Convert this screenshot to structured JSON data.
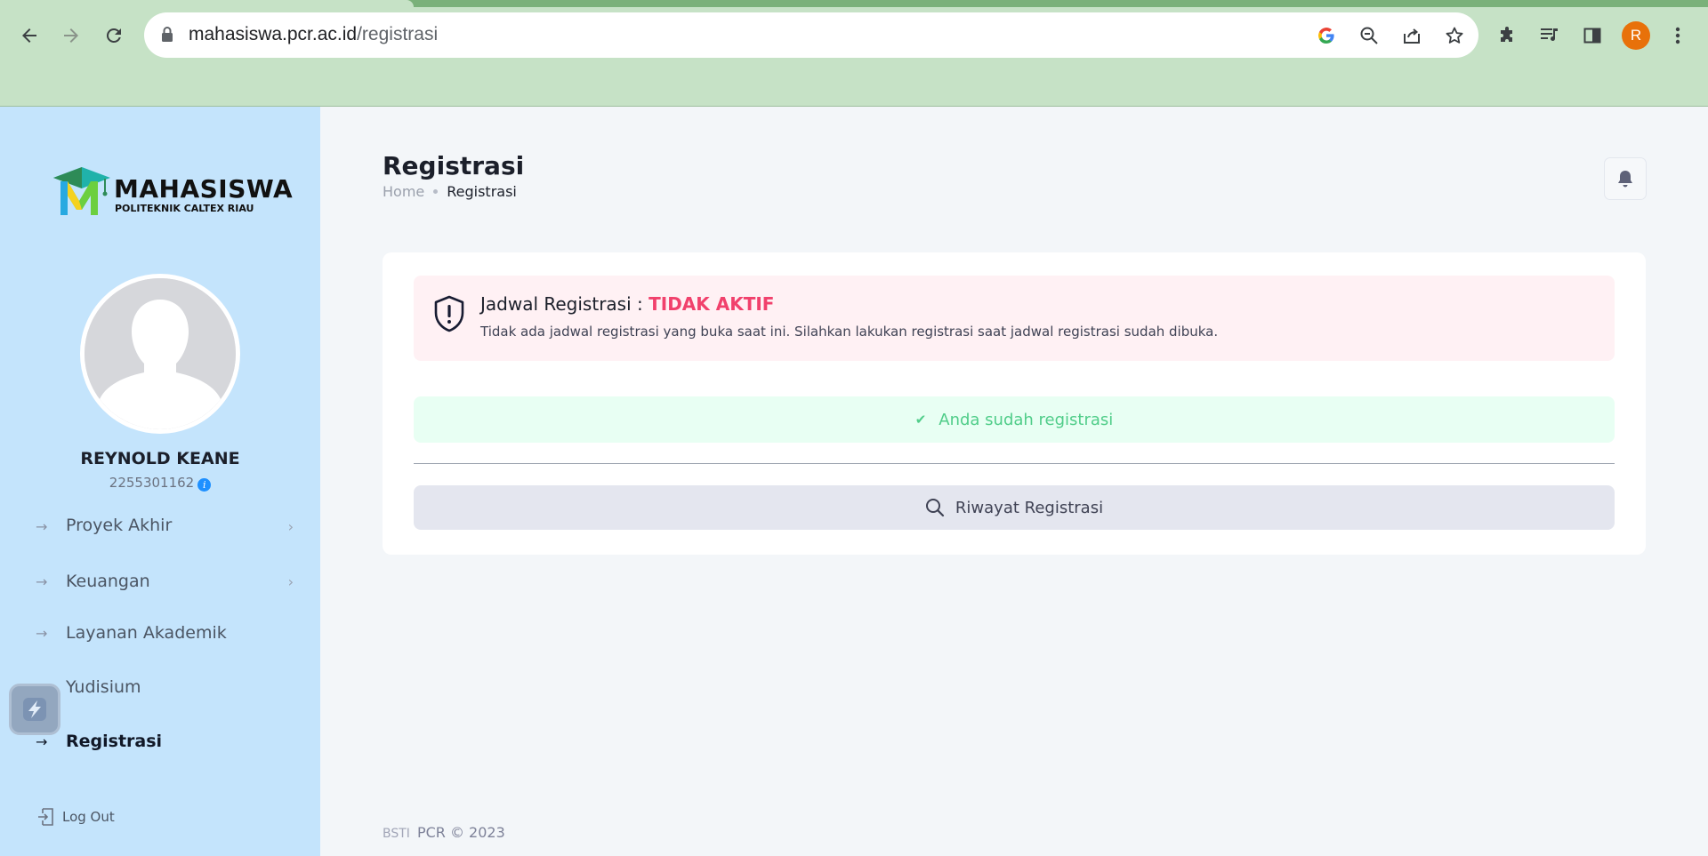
{
  "browser": {
    "url_domain": "mahasiswa.pcr.ac.id",
    "url_path": "/registrasi",
    "profile_initial": "R",
    "icons": [
      "back-icon",
      "forward-icon",
      "reload-icon",
      "lock-icon",
      "google-icon",
      "zoom-out-icon",
      "share-icon",
      "star-icon",
      "extensions-icon",
      "media-queue-icon",
      "side-panel-icon",
      "menu-dots-icon"
    ]
  },
  "sidebar": {
    "brand": "MAHASISWA",
    "brand_sub": "POLITEKNIK CALTEX RIAU",
    "user": {
      "name": "REYNOLD KEANE",
      "nim": "2255301162",
      "info_glyph": "i"
    },
    "menu": [
      {
        "label": "Proyek Akhir",
        "has_children": true
      },
      {
        "label": "Keuangan",
        "has_children": true
      },
      {
        "label": "Layanan Akademik",
        "has_children": false
      },
      {
        "label": "Yudisium",
        "has_children": false
      },
      {
        "label": "Registrasi",
        "has_children": false,
        "active": true
      }
    ],
    "logout": "Log Out"
  },
  "header": {
    "title": "Registrasi",
    "breadcrumb": {
      "home": "Home",
      "current": "Registrasi"
    }
  },
  "content": {
    "alert": {
      "title": "Jadwal Registrasi :",
      "status": "TIDAK AKTIF",
      "desc": "Tidak ada jadwal registrasi yang buka saat ini. Silahkan lakukan registrasi saat jadwal registrasi sudah dibuka."
    },
    "success_text": "Anda sudah registrasi",
    "history_button": "Riwayat Registrasi"
  },
  "footer": {
    "org": "BSTI",
    "copy": "PCR © 2023"
  },
  "colors": {
    "sidebar_bg": "#c4e4fc",
    "page_bg": "#f3f6f9",
    "danger": "#f1416c",
    "success": "#50cd89",
    "browser_bg": "#c6e2c6"
  }
}
